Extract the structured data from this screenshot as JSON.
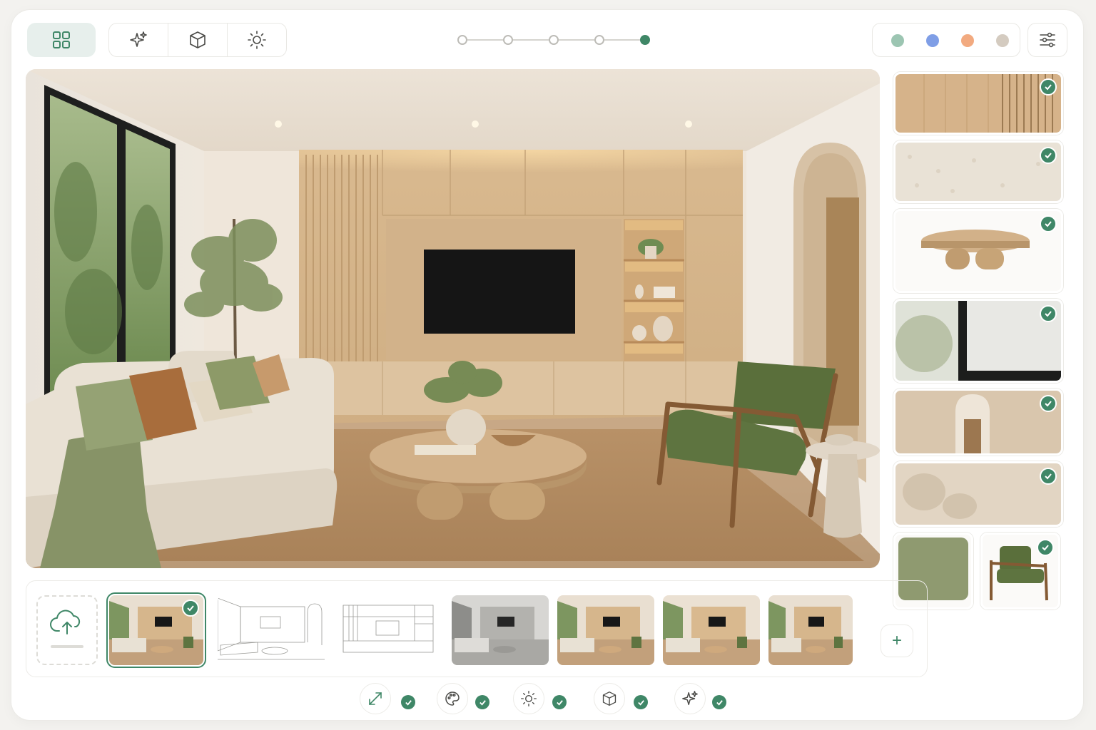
{
  "toolbar": {
    "view_icon": "grid-icon",
    "tools": [
      {
        "icon": "sparkle-icon"
      },
      {
        "icon": "cube-icon"
      },
      {
        "icon": "sun-icon"
      }
    ],
    "settings_icon": "sliders-icon"
  },
  "progress": {
    "total_steps": 5,
    "current_step": 5
  },
  "palette": {
    "colors": [
      "#9cc5b2",
      "#7f9ee6",
      "#f2aa80",
      "#d4cbc0"
    ]
  },
  "colors": {
    "accent": "#3f8767",
    "grid_button_bg": "#e7efec"
  },
  "materials": [
    {
      "name": "wood-slat-panel",
      "checked": true
    },
    {
      "name": "boucle-fabric",
      "checked": true
    },
    {
      "name": "round-coffee-table",
      "checked": true
    },
    {
      "name": "black-window-frame",
      "checked": true
    },
    {
      "name": "arched-doorway",
      "checked": true
    },
    {
      "name": "shadow-wall",
      "checked": true
    },
    {
      "name": "green-cushion",
      "checked": false
    },
    {
      "name": "green-armchair",
      "checked": true
    }
  ],
  "filmstrip": {
    "upload_icon": "cloud-upload-icon",
    "thumbnails": [
      {
        "style": "render",
        "selected": true
      },
      {
        "style": "sketch",
        "selected": false
      },
      {
        "style": "elevation",
        "selected": false
      },
      {
        "style": "grayscale",
        "selected": false
      },
      {
        "style": "render",
        "selected": false
      },
      {
        "style": "render",
        "selected": false
      },
      {
        "style": "render",
        "selected": false
      }
    ],
    "add_label": "+"
  },
  "bottom_tools": [
    {
      "icon": "expand-icon",
      "checked": true
    },
    {
      "icon": "palette-icon",
      "checked": true
    },
    {
      "icon": "sun-icon",
      "checked": true
    },
    {
      "icon": "cube-icon",
      "checked": true
    },
    {
      "icon": "sparkle-icon",
      "checked": true
    }
  ]
}
